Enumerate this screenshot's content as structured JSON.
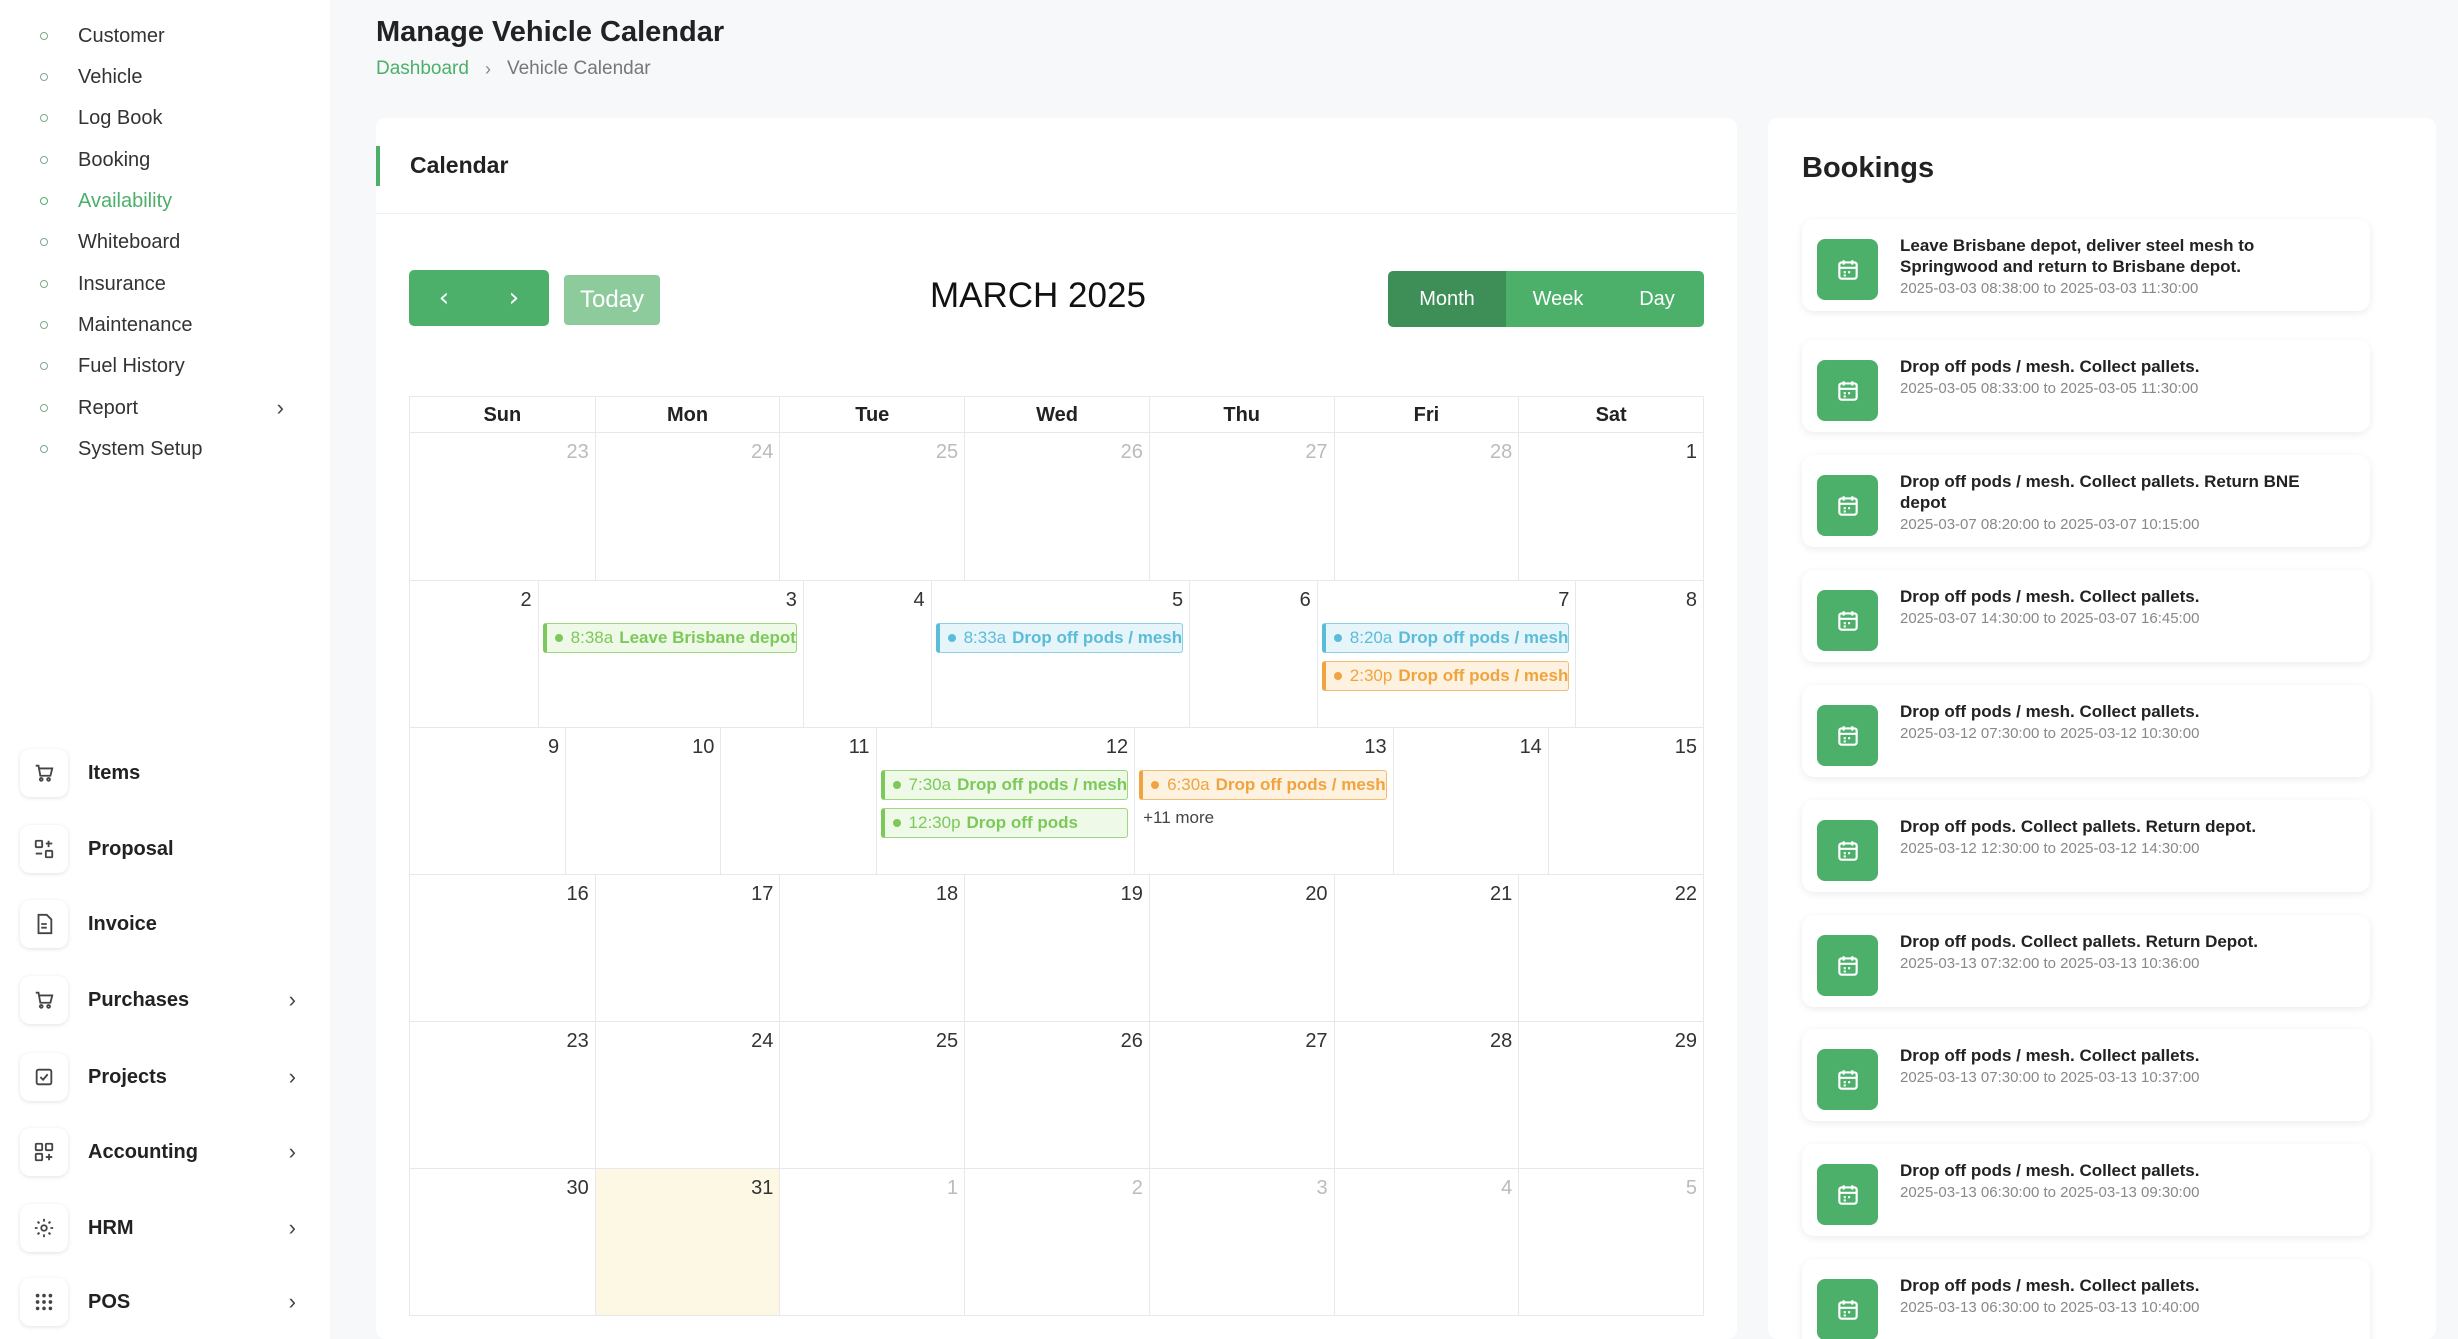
{
  "sidebar": {
    "sub_items": [
      {
        "label": "Customer",
        "active": false
      },
      {
        "label": "Vehicle",
        "active": false
      },
      {
        "label": "Log Book",
        "active": false
      },
      {
        "label": "Booking",
        "active": false
      },
      {
        "label": "Availability",
        "active": true
      },
      {
        "label": "Whiteboard",
        "active": false
      },
      {
        "label": "Insurance",
        "active": false
      },
      {
        "label": "Maintenance",
        "active": false
      },
      {
        "label": "Fuel History",
        "active": false
      },
      {
        "label": "Report",
        "active": false,
        "has_children": true
      },
      {
        "label": "System Setup",
        "active": false
      }
    ],
    "main_items": [
      {
        "label": "Items",
        "icon": "cart-icon",
        "has_children": false
      },
      {
        "label": "Proposal",
        "icon": "proposal-icon",
        "has_children": false
      },
      {
        "label": "Invoice",
        "icon": "invoice-icon",
        "has_children": false
      },
      {
        "label": "Purchases",
        "icon": "cart-icon",
        "has_children": true
      },
      {
        "label": "Projects",
        "icon": "checkbox-icon",
        "has_children": true
      },
      {
        "label": "Accounting",
        "icon": "grid-plus-icon",
        "has_children": true
      },
      {
        "label": "HRM",
        "icon": "hrm-icon",
        "has_children": true
      },
      {
        "label": "POS",
        "icon": "dots-grid-icon",
        "has_children": true
      }
    ]
  },
  "header": {
    "title": "Manage Vehicle Calendar",
    "breadcrumb": [
      "Dashboard",
      "Vehicle Calendar"
    ]
  },
  "calendar": {
    "card_title": "Calendar",
    "today_label": "Today",
    "month_label": "MARCH 2025",
    "views": [
      "Month",
      "Week",
      "Day"
    ],
    "active_view": "Month",
    "days_of_week": [
      "Sun",
      "Mon",
      "Tue",
      "Wed",
      "Thu",
      "Fri",
      "Sat"
    ],
    "weeks": [
      [
        {
          "n": "23",
          "muted": true
        },
        {
          "n": "24",
          "muted": true
        },
        {
          "n": "25",
          "muted": true
        },
        {
          "n": "26",
          "muted": true
        },
        {
          "n": "27",
          "muted": true
        },
        {
          "n": "28",
          "muted": true
        },
        {
          "n": "1"
        }
      ],
      [
        {
          "n": "2"
        },
        {
          "n": "3",
          "events": [
            {
              "time": "8:38a",
              "title": "Leave Brisbane depot",
              "color": "green"
            }
          ]
        },
        {
          "n": "4"
        },
        {
          "n": "5",
          "events": [
            {
              "time": "8:33a",
              "title": "Drop off pods / mesh",
              "color": "blue"
            }
          ]
        },
        {
          "n": "6"
        },
        {
          "n": "7",
          "events": [
            {
              "time": "8:20a",
              "title": "Drop off pods / mesh",
              "color": "blue"
            },
            {
              "time": "2:30p",
              "title": "Drop off pods / mesh",
              "color": "orange"
            }
          ]
        },
        {
          "n": "8"
        }
      ],
      [
        {
          "n": "9"
        },
        {
          "n": "10"
        },
        {
          "n": "11"
        },
        {
          "n": "12",
          "events": [
            {
              "time": "7:30a",
              "title": "Drop off pods / mesh",
              "color": "green"
            },
            {
              "time": "12:30p",
              "title": "Drop off pods",
              "color": "green"
            }
          ]
        },
        {
          "n": "13",
          "events": [
            {
              "time": "6:30a",
              "title": "Drop off pods / mesh",
              "color": "orange"
            }
          ],
          "more": "+11 more"
        },
        {
          "n": "14"
        },
        {
          "n": "15"
        }
      ],
      [
        {
          "n": "16"
        },
        {
          "n": "17"
        },
        {
          "n": "18"
        },
        {
          "n": "19"
        },
        {
          "n": "20"
        },
        {
          "n": "21"
        },
        {
          "n": "22"
        }
      ],
      [
        {
          "n": "23"
        },
        {
          "n": "24"
        },
        {
          "n": "25"
        },
        {
          "n": "26"
        },
        {
          "n": "27"
        },
        {
          "n": "28"
        },
        {
          "n": "29"
        }
      ],
      [
        {
          "n": "30"
        },
        {
          "n": "31",
          "today": true
        },
        {
          "n": "1",
          "muted": true
        },
        {
          "n": "2",
          "muted": true
        },
        {
          "n": "3",
          "muted": true
        },
        {
          "n": "4",
          "muted": true
        },
        {
          "n": "5",
          "muted": true
        }
      ]
    ]
  },
  "bookings": {
    "title": "Bookings",
    "items": [
      {
        "name": "Leave Brisbane depot, deliver steel mesh to Springwood and return to Brisbane depot.",
        "dates": "2025-03-03 08:38:00 to 2025-03-03 11:30:00"
      },
      {
        "name": "Drop off pods / mesh. Collect pallets.",
        "dates": "2025-03-05 08:33:00 to 2025-03-05 11:30:00"
      },
      {
        "name": "Drop off pods / mesh. Collect pallets. Return BNE depot",
        "dates": "2025-03-07 08:20:00 to 2025-03-07 10:15:00"
      },
      {
        "name": "Drop off pods / mesh. Collect pallets.",
        "dates": "2025-03-07 14:30:00 to 2025-03-07 16:45:00"
      },
      {
        "name": "Drop off pods / mesh. Collect pallets.",
        "dates": "2025-03-12 07:30:00 to 2025-03-12 10:30:00"
      },
      {
        "name": "Drop off pods. Collect pallets. Return depot.",
        "dates": "2025-03-12 12:30:00 to 2025-03-12 14:30:00"
      },
      {
        "name": "Drop off pods. Collect pallets. Return Depot.",
        "dates": "2025-03-13 07:32:00 to 2025-03-13 10:36:00"
      },
      {
        "name": "Drop off pods / mesh. Collect pallets.",
        "dates": "2025-03-13 07:30:00 to 2025-03-13 10:37:00"
      },
      {
        "name": "Drop off pods / mesh. Collect pallets.",
        "dates": "2025-03-13 06:30:00 to 2025-03-13 09:30:00"
      },
      {
        "name": "Drop off pods / mesh. Collect pallets.",
        "dates": "2025-03-13 06:30:00 to 2025-03-13 10:40:00"
      }
    ]
  },
  "colors": {
    "accent": "#4caf6a",
    "accent_dark": "#3d8f57",
    "event_green": "#7cc95a",
    "event_blue": "#5bbcd8",
    "event_orange": "#f0a43f",
    "today_bg": "#fdf8e4"
  }
}
